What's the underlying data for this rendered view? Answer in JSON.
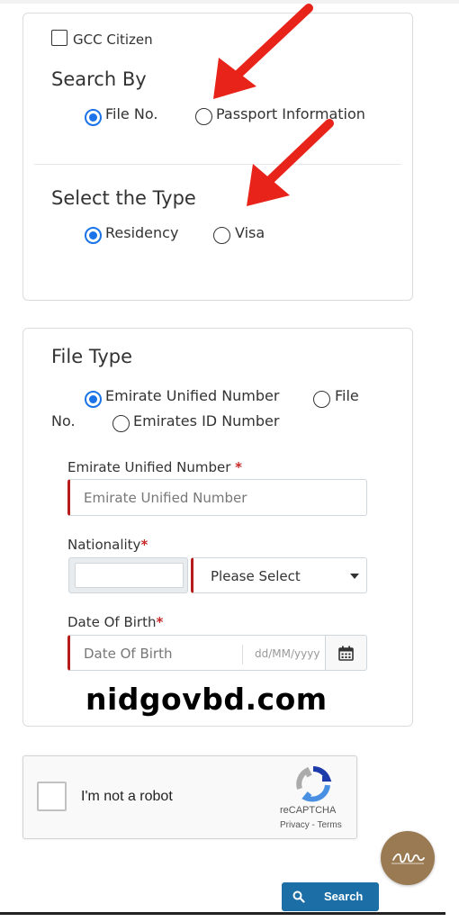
{
  "search_section": {
    "gcc_label": "GCC Citizen",
    "search_by_title": "Search By",
    "search_by_options": [
      "File No.",
      "Passport Information"
    ],
    "search_by_selected": "File No.",
    "type_title": "Select the Type",
    "type_options": [
      "Residency",
      "Visa"
    ],
    "type_selected": "Residency"
  },
  "file_type_section": {
    "title": "File Type",
    "options": {
      "unified": "Emirate Unified Number",
      "file_part1": "File",
      "file_part2": "No.",
      "eid": "Emirates ID Number"
    },
    "selected": "Emirate Unified Number",
    "unified_field": {
      "label": "Emirate Unified Number",
      "required_mark": "*",
      "placeholder": "Emirate Unified Number"
    },
    "nationality_field": {
      "label": "Nationality",
      "required_mark": "*",
      "selected_value": "Please Select"
    },
    "dob_field": {
      "label": "Date Of Birth",
      "required_mark": "*",
      "placeholder": "Date Of Birth",
      "format_hint": "dd/MM/yyyy"
    }
  },
  "watermark_text": "nidgovbd.com",
  "captcha": {
    "label": "I'm not a robot",
    "brand": "reCAPTCHA",
    "links": "Privacy - Terms"
  },
  "search_button": {
    "label": "Search",
    "icon": "search-icon"
  },
  "colors": {
    "accent": "#1a73e8",
    "required": "#c62828",
    "button": "#1b6fa6",
    "arrow": "#e8231a"
  }
}
